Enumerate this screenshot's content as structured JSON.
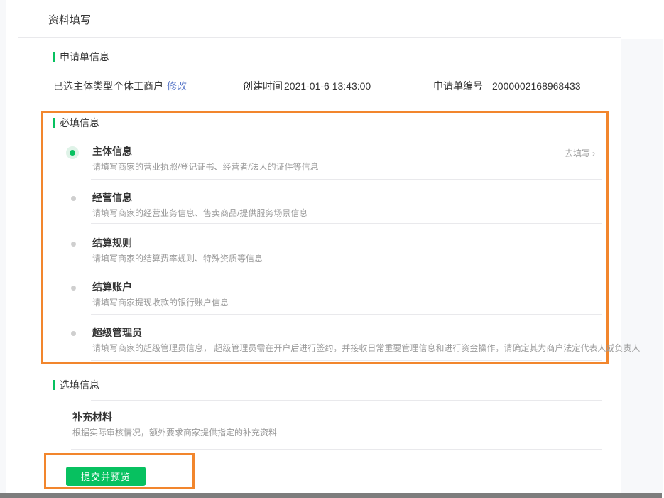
{
  "page": {
    "title": "资料填写"
  },
  "application_info": {
    "section_title": "申请单信息",
    "fields": [
      {
        "label": "已选主体类型",
        "value": "个体工商户",
        "action": "修改"
      },
      {
        "label": "创建时间",
        "value": "2021-01-6 13:43:00"
      },
      {
        "label": "申请单编号",
        "value": "2000002168968433"
      }
    ]
  },
  "required_section": {
    "title": "必填信息",
    "go_fill_label": "去填写",
    "chevron": "›",
    "items": [
      {
        "title": "主体信息",
        "desc": "请填写商家的营业执照/登记证书、经营者/法人的证件等信息",
        "state": "selected"
      },
      {
        "title": "经营信息",
        "desc": "请填写商家的经营业务信息、售卖商品/提供服务场景信息",
        "state": "pending"
      },
      {
        "title": "结算规则",
        "desc": "请填写商家的结算费率规则、特殊资质等信息",
        "state": "pending"
      },
      {
        "title": "结算账户",
        "desc": "请填写商家提现收款的银行账户信息",
        "state": "pending"
      },
      {
        "title": "超级管理员",
        "desc": "请填写商家的超级管理员信息， 超级管理员需在开户后进行签约，并接收日常重要管理信息和进行资金操作，请确定其为商户法定代表人或负责人",
        "state": "pending"
      }
    ]
  },
  "optional_section": {
    "title": "选填信息",
    "items": [
      {
        "title": "补充材料",
        "desc": "根据实际审核情况，额外要求商家提供指定的补充资料"
      }
    ]
  },
  "submit_button": {
    "label": "提交并预览"
  },
  "colors": {
    "accent_green": "#07c160",
    "link_blue": "#5a78c8",
    "highlight_orange": "#f2862d",
    "divider": "#e9e9ec",
    "text_primary": "#333333",
    "text_secondary": "#999999",
    "bottom_bar_gray": "#7d7d7d"
  }
}
